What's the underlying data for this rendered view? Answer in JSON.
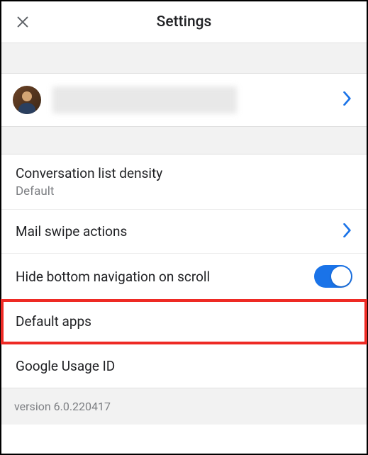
{
  "header": {
    "title": "Settings"
  },
  "account": {
    "name_redacted": true
  },
  "settings": {
    "conversation_density": {
      "label": "Conversation list density",
      "value": "Default"
    },
    "mail_swipe": {
      "label": "Mail swipe actions"
    },
    "hide_nav": {
      "label": "Hide bottom navigation on scroll",
      "enabled": true
    },
    "default_apps": {
      "label": "Default apps"
    },
    "usage_id": {
      "label": "Google Usage ID"
    }
  },
  "footer": {
    "version": "version 6.0.220417"
  }
}
